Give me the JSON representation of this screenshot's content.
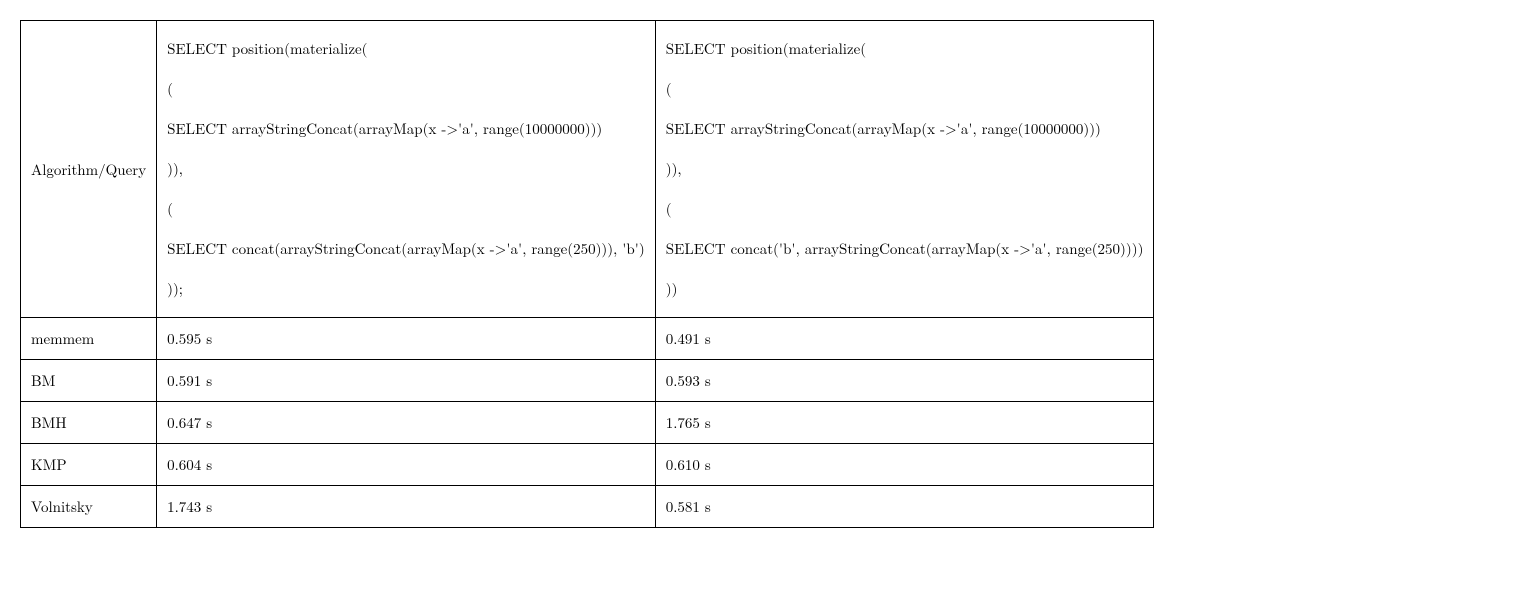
{
  "header": {
    "label": "Algorithm/Query",
    "query1_lines": [
      "SELECT position(materialize(",
      "(",
      "SELECT arrayStringConcat(arrayMap(x ->'a', range(10000000)))",
      ")),",
      "(",
      "SELECT concat(arrayStringConcat(arrayMap(x ->'a', range(250))), 'b')",
      "));"
    ],
    "query2_lines": [
      "SELECT position(materialize(",
      "(",
      "SELECT arrayStringConcat(arrayMap(x ->'a', range(10000000)))",
      ")),",
      "(",
      "SELECT concat('b', arrayStringConcat(arrayMap(x ->'a', range(250))))",
      "))"
    ]
  },
  "rows": [
    {
      "algo": "memmem",
      "q1": "0.595 s",
      "q2": "0.491 s"
    },
    {
      "algo": "BM",
      "q1": "0.591 s",
      "q2": "0.593 s"
    },
    {
      "algo": "BMH",
      "q1": "0.647 s",
      "q2": "1.765 s"
    },
    {
      "algo": "KMP",
      "q1": "0.604 s",
      "q2": "0.610 s"
    },
    {
      "algo": "Volnitsky",
      "q1": "1.743 s",
      "q2": "0.581 s"
    }
  ]
}
